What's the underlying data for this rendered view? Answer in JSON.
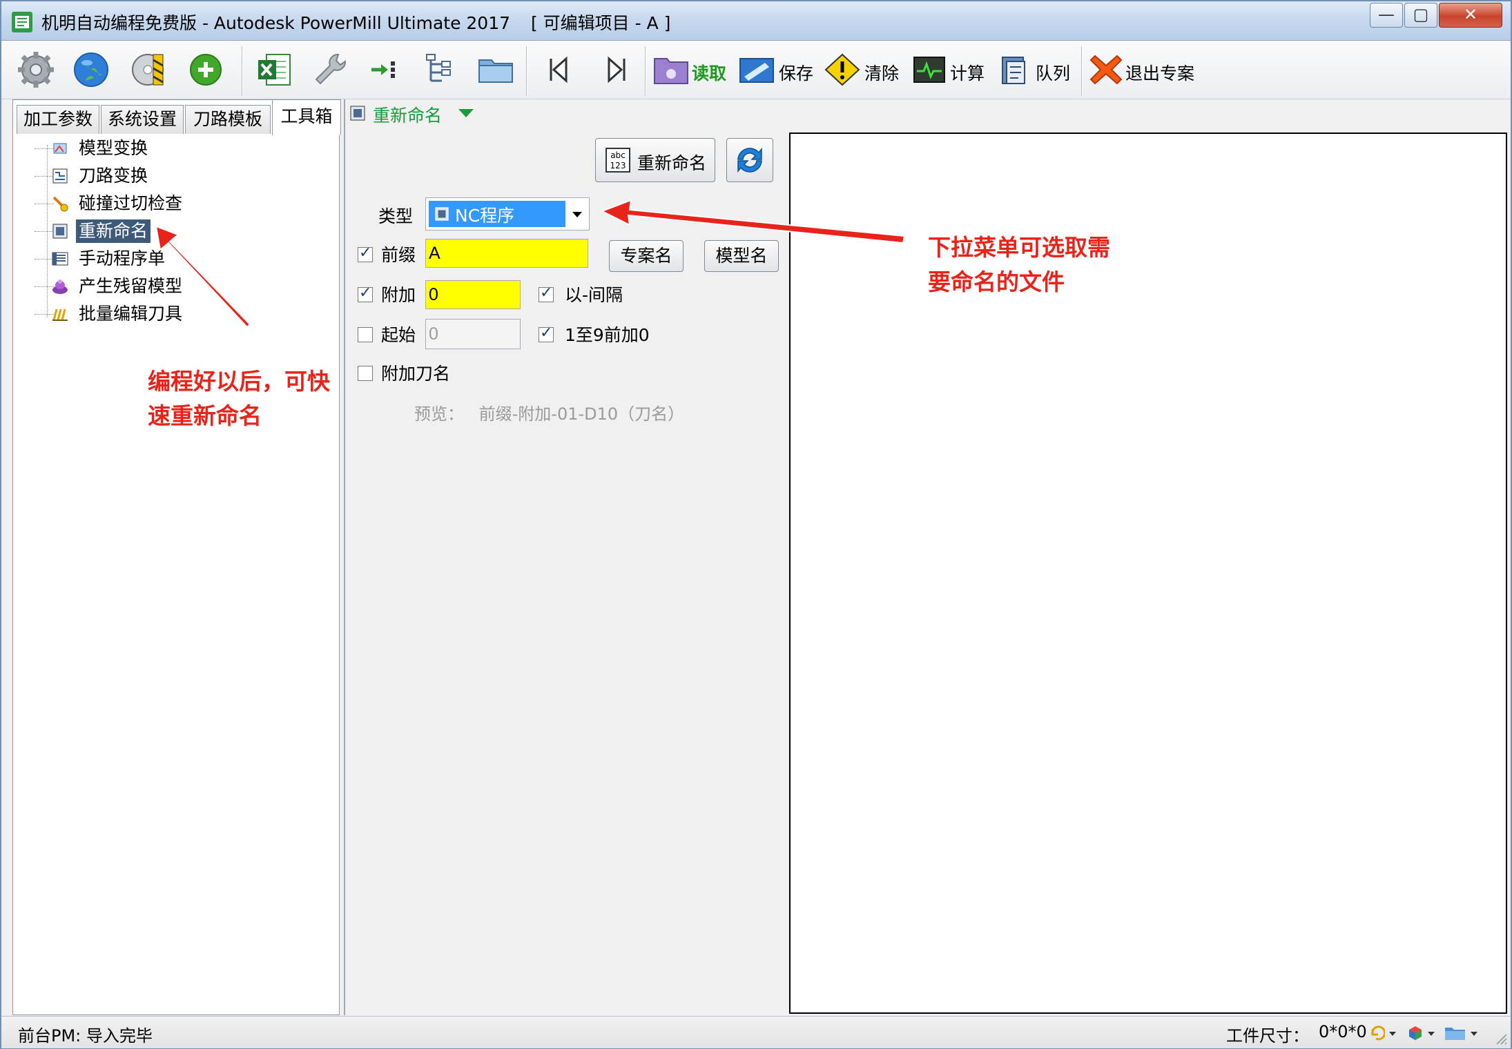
{
  "window": {
    "title": "机明自动编程免费版 - Autodesk PowerMill Ultimate 2017",
    "project": "[ 可编辑项目 - A ]",
    "min_symbol": "—",
    "max_symbol": "▢",
    "close_symbol": "✕"
  },
  "toolbar": {
    "icons": [
      "gear-icon",
      "globe-icon",
      "disk-icon",
      "add-icon",
      "excel-icon",
      "wrench-icon",
      "import-icon",
      "tree-icon",
      "folder-icon",
      "first-icon",
      "last-icon"
    ],
    "buttons": [
      {
        "name": "read",
        "label": "读取",
        "color": "#1f9a1f"
      },
      {
        "name": "save",
        "label": "保存",
        "color": "#000000"
      },
      {
        "name": "clear",
        "label": "清除",
        "color": "#000000"
      },
      {
        "name": "calculate",
        "label": "计算",
        "color": "#000000"
      },
      {
        "name": "queue",
        "label": "队列",
        "color": "#000000"
      },
      {
        "name": "exit",
        "label": "退出专案",
        "color": "#000000"
      }
    ]
  },
  "left_tabs": [
    "加工参数",
    "系统设置",
    "刀路模板",
    "工具箱"
  ],
  "active_tab": "工具箱",
  "tree_items": [
    {
      "label": "模型变换",
      "icon": "model-transform-icon"
    },
    {
      "label": "刀路变换",
      "icon": "toolpath-transform-icon"
    },
    {
      "label": "碰撞过切检查",
      "icon": "collision-check-icon"
    },
    {
      "label": "重新命名",
      "icon": "rename-icon",
      "selected": true
    },
    {
      "label": "手动程序单",
      "icon": "program-sheet-icon"
    },
    {
      "label": "产生残留模型",
      "icon": "stock-model-icon"
    },
    {
      "label": "批量编辑刀具",
      "icon": "batch-tool-icon"
    }
  ],
  "panel": {
    "header": "重新命名",
    "rename_button": "重新命名",
    "type_label": "类型",
    "type_value": "NC程序",
    "prefix_label": "前缀",
    "prefix_checked": true,
    "prefix_value": "A",
    "project_name_button": "专案名",
    "model_name_button": "模型名",
    "append_label": "附加",
    "append_checked": true,
    "append_value": "0",
    "dash_sep_label": "以-间隔",
    "dash_sep_checked": true,
    "start_label": "起始",
    "start_checked": false,
    "start_value": "0",
    "pad_zero_label": "1至9前加0",
    "pad_zero_checked": true,
    "append_tool_label": "附加刀名",
    "append_tool_checked": false,
    "preview_label": "预览：",
    "preview_value": "前缀-附加-01-D10（刀名）"
  },
  "status": {
    "left": "前台PM: 导入完毕",
    "size_label": "工件尺寸：",
    "size_value": "0*0*0"
  },
  "annotations": {
    "left_line1": "编程好以后，可快",
    "left_line2": "速重新命名",
    "right_line1": "下拉菜单可选取需",
    "right_line2": "要命名的文件",
    "color": "#e8231a"
  }
}
